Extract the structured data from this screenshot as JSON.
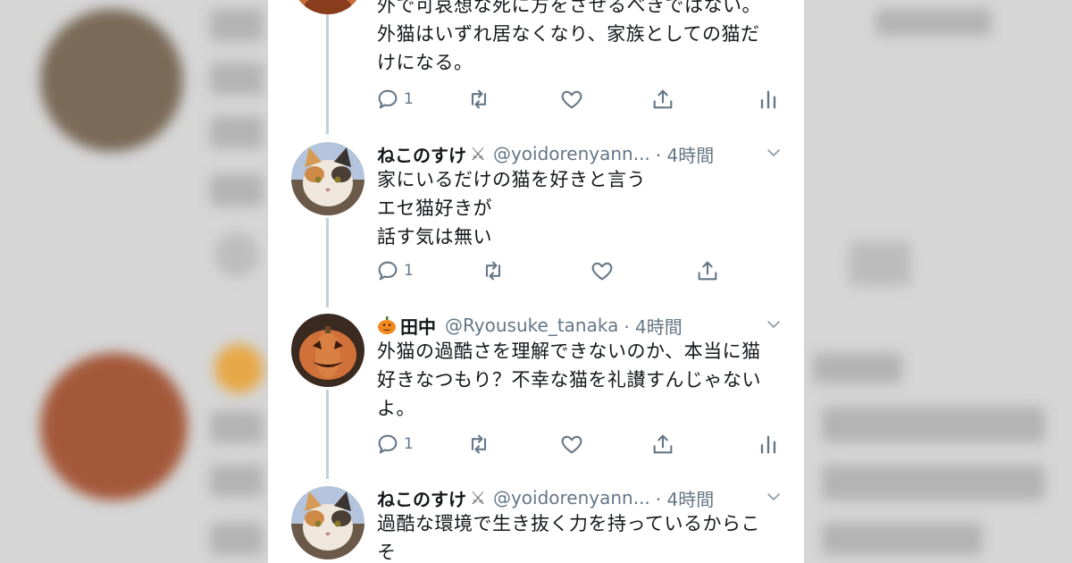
{
  "tweets": [
    {
      "text_lines": [
        "外で可哀想な死に方をさせるべきではない。",
        "外猫はいずれ居なくなり、家族としての猫だ",
        "けになる。"
      ],
      "reply_count": "1"
    },
    {
      "name": "ねこのすけ",
      "badge_icon": "crossed-swords-icon",
      "handle": "@yoidorenyann...",
      "time": "· 4時間",
      "text_lines": [
        "家にいるだけの猫を好きと言う",
        "エセ猫好きが",
        "話す気は無い"
      ],
      "reply_count": "1"
    },
    {
      "name": "田中",
      "badge_icon": "jack-o-lantern-icon",
      "handle": "@Ryousuke_tanaka",
      "time": "· 4時間",
      "text_lines": [
        "外猫の過酷さを理解できないのか、本当に猫",
        "好きなつもり？不幸な猫を礼讃すんじゃない",
        "よ。"
      ],
      "reply_count": "1"
    },
    {
      "name": "ねこのすけ",
      "badge_icon": "crossed-swords-icon",
      "handle": "@yoidorenyann...",
      "time": "· 4時間",
      "text_lines": [
        "過酷な環境で生き抜く力を持っているからこ",
        "そ"
      ]
    }
  ],
  "icons": {
    "reply": "reply-icon",
    "retweet": "retweet-icon",
    "like": "heart-icon",
    "share": "share-icon",
    "analytics": "analytics-icon",
    "caret": "chevron-down-icon"
  },
  "colors": {
    "text": "#14171a",
    "secondary": "#657786",
    "thread_line": "#c4cfd6"
  }
}
